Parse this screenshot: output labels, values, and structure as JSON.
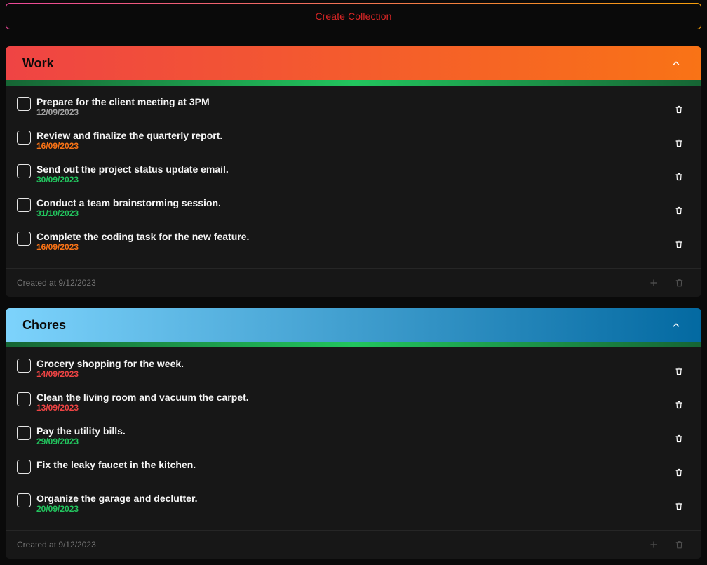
{
  "create_button_label": "Create Collection",
  "collections": [
    {
      "title": "Work",
      "created": "Created at 9/12/2023",
      "gradient": [
        "#ef4444",
        "#f97316"
      ],
      "tasks": [
        {
          "text": "Prepare for the client meeting at 3PM",
          "date": "12/09/2023",
          "date_color": "#a3a3a3"
        },
        {
          "text": "Review and finalize the quarterly report.",
          "date": "16/09/2023",
          "date_color": "#f97316"
        },
        {
          "text": "Send out the project status update email.",
          "date": "30/09/2023",
          "date_color": "#22c55e"
        },
        {
          "text": "Conduct a team brainstorming session.",
          "date": "31/10/2023",
          "date_color": "#22c55e"
        },
        {
          "text": "Complete the coding task for the new feature.",
          "date": "16/09/2023",
          "date_color": "#f97316"
        }
      ]
    },
    {
      "title": "Chores",
      "created": "Created at 9/12/2023",
      "gradient": [
        "#7dd3fc",
        "#0369a1"
      ],
      "tasks": [
        {
          "text": "Grocery shopping for the week.",
          "date": "14/09/2023",
          "date_color": "#ef4444"
        },
        {
          "text": "Clean the living room and vacuum the carpet.",
          "date": "13/09/2023",
          "date_color": "#ef4444"
        },
        {
          "text": "Pay the utility bills.",
          "date": "29/09/2023",
          "date_color": "#22c55e"
        },
        {
          "text": "Fix the leaky faucet in the kitchen.",
          "date": "",
          "date_color": "#22c55e"
        },
        {
          "text": "Organize the garage and declutter.",
          "date": "20/09/2023",
          "date_color": "#22c55e"
        }
      ]
    }
  ],
  "icons": {
    "chevron": "chevron-up-icon",
    "trash": "trash-icon",
    "plus": "plus-icon"
  }
}
